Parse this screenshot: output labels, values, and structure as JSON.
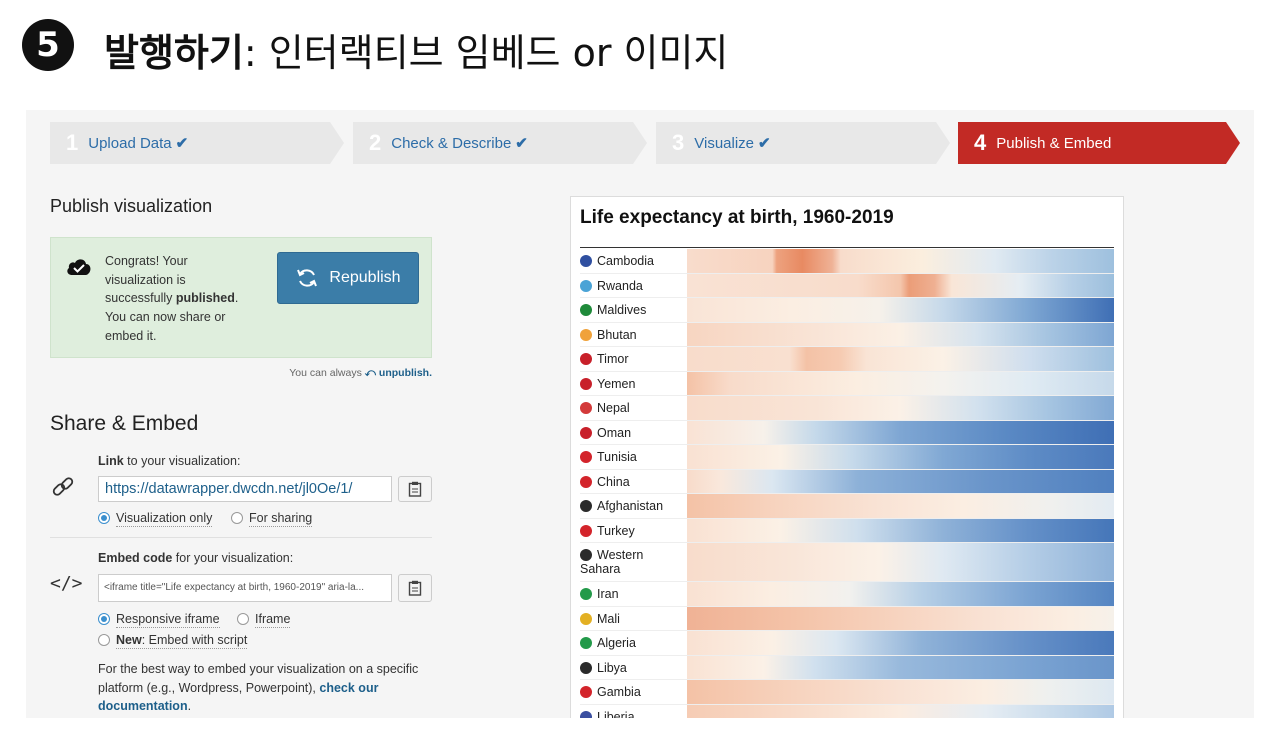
{
  "slide": {
    "number": "5",
    "title_bold": "발행하기",
    "title_rest": ": 인터랙티브 임베드 or 이미지"
  },
  "steps": [
    {
      "num": "1",
      "label": "Upload Data",
      "done": true
    },
    {
      "num": "2",
      "label": "Check & Describe",
      "done": true
    },
    {
      "num": "3",
      "label": "Visualize",
      "done": true
    },
    {
      "num": "4",
      "label": "Publish & Embed",
      "done": false
    }
  ],
  "publish": {
    "heading": "Publish visualization",
    "congrats_1": "Congrats! Your visualization is successfully ",
    "congrats_bold": "published",
    "congrats_2": ". You can now share or embed it.",
    "republish_label": "Republish",
    "unpublish_prefix": "You can always ",
    "unpublish_link": "unpublish."
  },
  "share": {
    "heading": "Share & Embed",
    "link_bold": "Link",
    "link_rest": " to your visualization:",
    "url": "https://datawrapper.dwcdn.net/jl0Oe/1/",
    "opt_visualization": "Visualization only",
    "opt_sharing": "For sharing",
    "embed_bold": "Embed code",
    "embed_rest": " for your visualization:",
    "embed_code": "<iframe title=\"Life expectancy at birth, 1960-2019\" aria-la...",
    "opt_responsive": "Responsive iframe",
    "opt_iframe": "Iframe",
    "opt_new_bold": "New",
    "opt_new_rest": ": Embed with script",
    "bestway_1": "For the best way to embed your visualization on a specific platform (e.g., Wordpress, Powerpoint), ",
    "bestway_link": "check our documentation",
    "bestway_2": "."
  },
  "colors": {
    "accent_red": "#c22a25",
    "tab_grey": "#e8e8e8",
    "link_blue": "#2d6da8",
    "button_blue": "#3b7da8",
    "congrats_green": "#dfeedd",
    "heat_low": "#e8825a",
    "heat_mid": "#fbf3e8",
    "heat_high": "#3f6fb5"
  },
  "chart_data": {
    "type": "heatmap",
    "title": "Life expectancy at birth, 1960-2019",
    "rows": [
      {
        "name": "Cambodia",
        "flag": "#2f4fa0",
        "stops": [
          [
            0,
            "#f8dccc"
          ],
          [
            0.2,
            "#f7d3bf"
          ],
          [
            0.21,
            "#eda27f"
          ],
          [
            0.27,
            "#e88a62"
          ],
          [
            0.34,
            "#efb296"
          ],
          [
            0.36,
            "#f8dccb"
          ],
          [
            0.55,
            "#fbeede"
          ],
          [
            0.72,
            "#e0eaf2"
          ],
          [
            0.85,
            "#bcd3e8"
          ],
          [
            1,
            "#9ec0de"
          ]
        ]
      },
      {
        "name": "Rwanda",
        "flag": "#4aa3d6",
        "stops": [
          [
            0,
            "#f9e2d4"
          ],
          [
            0.4,
            "#f8dccb"
          ],
          [
            0.5,
            "#f4c6ac"
          ],
          [
            0.52,
            "#eb9d78"
          ],
          [
            0.58,
            "#efb092"
          ],
          [
            0.62,
            "#f9e6d7"
          ],
          [
            0.78,
            "#e5edf3"
          ],
          [
            0.9,
            "#b6cfe6"
          ],
          [
            1,
            "#9cbfdd"
          ]
        ]
      },
      {
        "name": "Maldives",
        "flag": "#1f8a3a",
        "stops": [
          [
            0,
            "#f9e4d6"
          ],
          [
            0.25,
            "#fbeee2"
          ],
          [
            0.45,
            "#f6f1ea"
          ],
          [
            0.6,
            "#c6d9ea"
          ],
          [
            0.8,
            "#7ea7d3"
          ],
          [
            1,
            "#3f6fb5"
          ]
        ]
      },
      {
        "name": "Bhutan",
        "flag": "#f0a23a",
        "stops": [
          [
            0,
            "#f7d5c1"
          ],
          [
            0.3,
            "#f9e4d6"
          ],
          [
            0.5,
            "#fbf0e5"
          ],
          [
            0.68,
            "#d6e3ee"
          ],
          [
            0.85,
            "#a4c3e0"
          ],
          [
            1,
            "#7ea6d3"
          ]
        ]
      },
      {
        "name": "Timor",
        "flag": "#c8202a",
        "stops": [
          [
            0,
            "#f8dccb"
          ],
          [
            0.24,
            "#f9e0d0"
          ],
          [
            0.28,
            "#f4c2a6"
          ],
          [
            0.36,
            "#f6cbb2"
          ],
          [
            0.42,
            "#f9e4d5"
          ],
          [
            0.6,
            "#fbf1e6"
          ],
          [
            0.8,
            "#cfdeee"
          ],
          [
            1,
            "#9ec0de"
          ]
        ]
      },
      {
        "name": "Yemen",
        "flag": "#c8202a",
        "stops": [
          [
            0,
            "#f4c2a6"
          ],
          [
            0.1,
            "#f8dbca"
          ],
          [
            0.4,
            "#fbeee1"
          ],
          [
            0.6,
            "#f4f2ee"
          ],
          [
            0.8,
            "#e0ebf3"
          ],
          [
            1,
            "#c6d9ea"
          ]
        ]
      },
      {
        "name": "Nepal",
        "flag": "#d33a3a",
        "stops": [
          [
            0,
            "#f8dccb"
          ],
          [
            0.3,
            "#f9e4d6"
          ],
          [
            0.5,
            "#fbf1e7"
          ],
          [
            0.68,
            "#d2e1ee"
          ],
          [
            0.85,
            "#a5c4e1"
          ],
          [
            1,
            "#82a9d4"
          ]
        ]
      },
      {
        "name": "Oman",
        "flag": "#c8202a",
        "stops": [
          [
            0,
            "#f9e2d4"
          ],
          [
            0.18,
            "#f7f1ea"
          ],
          [
            0.3,
            "#c5d9ea"
          ],
          [
            0.5,
            "#7ea6d3"
          ],
          [
            0.75,
            "#5a89c4"
          ],
          [
            1,
            "#3f6fb5"
          ]
        ]
      },
      {
        "name": "Tunisia",
        "flag": "#d3242b",
        "stops": [
          [
            0,
            "#f9e1d2"
          ],
          [
            0.22,
            "#fbf1e6"
          ],
          [
            0.38,
            "#c8dbeb"
          ],
          [
            0.6,
            "#80a8d4"
          ],
          [
            0.8,
            "#5e8cc6"
          ],
          [
            1,
            "#4a79bb"
          ]
        ]
      },
      {
        "name": "China",
        "flag": "#d3242b",
        "stops": [
          [
            0,
            "#f8dbca"
          ],
          [
            0.08,
            "#f9e8dc"
          ],
          [
            0.2,
            "#dbe7f1"
          ],
          [
            0.4,
            "#8db1d8"
          ],
          [
            0.7,
            "#6a95ca"
          ],
          [
            1,
            "#5080bf"
          ]
        ]
      },
      {
        "name": "Afghanistan",
        "flag": "#2b2b2b",
        "stops": [
          [
            0,
            "#f4c2a6"
          ],
          [
            0.2,
            "#f7d3be"
          ],
          [
            0.45,
            "#f9e3d5"
          ],
          [
            0.65,
            "#fbeee2"
          ],
          [
            0.85,
            "#f0f0ee"
          ],
          [
            1,
            "#e3ebf2"
          ]
        ]
      },
      {
        "name": "Turkey",
        "flag": "#d3242b",
        "stops": [
          [
            0,
            "#f9e1d2"
          ],
          [
            0.22,
            "#fbf1e6"
          ],
          [
            0.4,
            "#cfdfed"
          ],
          [
            0.6,
            "#8fb2d8"
          ],
          [
            0.8,
            "#6490c8"
          ],
          [
            1,
            "#4576b9"
          ]
        ]
      },
      {
        "name": "Western Sahara",
        "flag": "#2b2b2b",
        "stops": [
          [
            0,
            "#f8dccb"
          ],
          [
            0.25,
            "#f9e6d9"
          ],
          [
            0.45,
            "#fbf1e7"
          ],
          [
            0.6,
            "#dfe9f2"
          ],
          [
            0.8,
            "#b4cde6"
          ],
          [
            1,
            "#8fb2d8"
          ]
        ]
      },
      {
        "name": "Iran",
        "flag": "#239a4a",
        "stops": [
          [
            0,
            "#f9e1d2"
          ],
          [
            0.2,
            "#fbeee2"
          ],
          [
            0.38,
            "#f2f1ee"
          ],
          [
            0.55,
            "#b6cfe6"
          ],
          [
            0.8,
            "#7aa3d2"
          ],
          [
            1,
            "#5585c2"
          ]
        ]
      },
      {
        "name": "Mali",
        "flag": "#e3b023",
        "stops": [
          [
            0,
            "#f0b295"
          ],
          [
            0.25,
            "#f4c3a8"
          ],
          [
            0.5,
            "#f7d4c0"
          ],
          [
            0.7,
            "#f9e2d4"
          ],
          [
            0.9,
            "#fbeee2"
          ],
          [
            1,
            "#f6f1ea"
          ]
        ]
      },
      {
        "name": "Algeria",
        "flag": "#239a4a",
        "stops": [
          [
            0,
            "#f9e1d2"
          ],
          [
            0.2,
            "#fbf0e5"
          ],
          [
            0.35,
            "#dbe7f1"
          ],
          [
            0.55,
            "#8fb2d8"
          ],
          [
            0.8,
            "#6590c8"
          ],
          [
            1,
            "#4a79bb"
          ]
        ]
      },
      {
        "name": "Libya",
        "flag": "#2b2b2b",
        "stops": [
          [
            0,
            "#f9e2d3"
          ],
          [
            0.18,
            "#fbf1e7"
          ],
          [
            0.3,
            "#d0e0ee"
          ],
          [
            0.5,
            "#98b9dc"
          ],
          [
            0.8,
            "#7aa3d2"
          ],
          [
            1,
            "#6a95ca"
          ]
        ]
      },
      {
        "name": "Gambia",
        "flag": "#d3242b",
        "stops": [
          [
            0,
            "#f4c2a6"
          ],
          [
            0.25,
            "#f7d3be"
          ],
          [
            0.5,
            "#f9e2d4"
          ],
          [
            0.7,
            "#fbeee2"
          ],
          [
            0.85,
            "#eef0ef"
          ],
          [
            1,
            "#dde8f1"
          ]
        ]
      },
      {
        "name": "Liberia",
        "flag": "#3a4fa0",
        "stops": [
          [
            0,
            "#f6ccb4"
          ],
          [
            0.25,
            "#f8dbc9"
          ],
          [
            0.5,
            "#fbece0"
          ],
          [
            0.7,
            "#e6edf3"
          ],
          [
            0.9,
            "#c2d7ea"
          ],
          [
            1,
            "#b0cae5"
          ]
        ]
      }
    ]
  }
}
